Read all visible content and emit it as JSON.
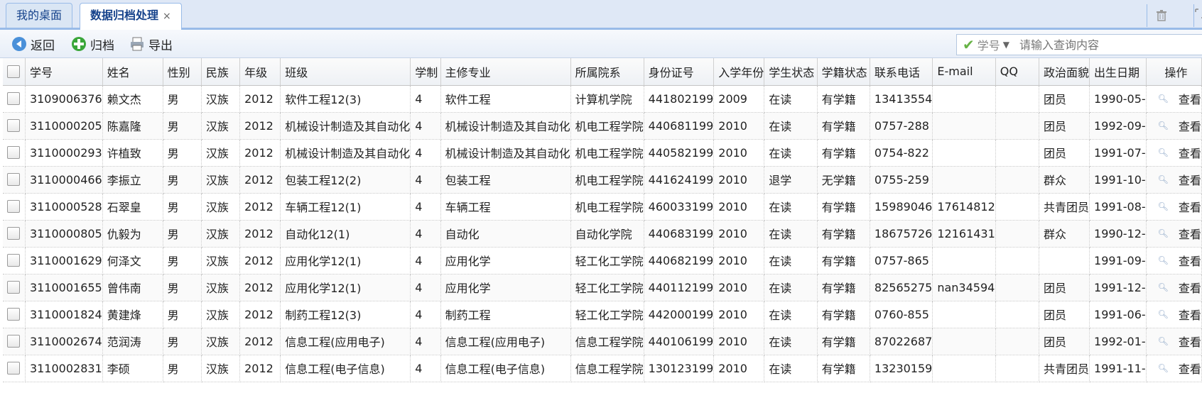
{
  "tabs": [
    {
      "label": "我的桌面",
      "active": false
    },
    {
      "label": "数据归档处理",
      "active": true,
      "close": "×"
    }
  ],
  "toolbar": {
    "back": "返回",
    "archive": "归档",
    "export": "导出"
  },
  "search": {
    "field": "学号",
    "placeholder": "请输入查询内容"
  },
  "columns": [
    "学号",
    "姓名",
    "性别",
    "民族",
    "年级",
    "班级",
    "学制",
    "主修专业",
    "所属院系",
    "身份证号",
    "入学年份",
    "学生状态",
    "学籍状态",
    "联系电话",
    "E-mail",
    "QQ",
    "政治面貌",
    "出生日期",
    "操作"
  ],
  "view_label": "查看",
  "rows": [
    [
      "3109006376",
      "赖文杰",
      "男",
      "汉族",
      "2012",
      "软件工程12(3)",
      "4",
      "软件工程",
      "计算机学院",
      "441802199",
      "2009",
      "在读",
      "有学籍",
      "13413554",
      "",
      "",
      "团员",
      "1990-05-"
    ],
    [
      "3110000205",
      "陈嘉隆",
      "男",
      "汉族",
      "2012",
      "机械设计制造及其自动化",
      "4",
      "机械设计制造及其自动化",
      "机电工程学院",
      "440681199",
      "2010",
      "在读",
      "有学籍",
      "0757-288",
      "",
      "",
      "团员",
      "1992-09-"
    ],
    [
      "3110000293",
      "许植致",
      "男",
      "汉族",
      "2012",
      "机械设计制造及其自动化",
      "4",
      "机械设计制造及其自动化",
      "机电工程学院",
      "440582199",
      "2010",
      "在读",
      "有学籍",
      "0754-822",
      "",
      "",
      "团员",
      "1991-07-"
    ],
    [
      "3110000466",
      "李振立",
      "男",
      "汉族",
      "2012",
      "包装工程12(2)",
      "4",
      "包装工程",
      "机电工程学院",
      "441624199",
      "2010",
      "退学",
      "无学籍",
      "0755-259",
      "",
      "",
      "群众",
      "1991-10-"
    ],
    [
      "3110000528",
      "石翠皇",
      "男",
      "汉族",
      "2012",
      "车辆工程12(1)",
      "4",
      "车辆工程",
      "机电工程学院",
      "460033199",
      "2010",
      "在读",
      "有学籍",
      "15989046",
      "17614812",
      "",
      "共青团员",
      "1991-08-"
    ],
    [
      "3110000805",
      "仇毅为",
      "男",
      "汉族",
      "2012",
      "自动化12(1)",
      "4",
      "自动化",
      "自动化学院",
      "440683199",
      "2010",
      "在读",
      "有学籍",
      "18675726",
      "12161431",
      "",
      "群众",
      "1990-12-"
    ],
    [
      "3110001629",
      "何泽文",
      "男",
      "汉族",
      "2012",
      "应用化学12(1)",
      "4",
      "应用化学",
      "轻工化工学院",
      "440682199",
      "2010",
      "在读",
      "有学籍",
      "0757-865",
      "",
      "",
      "",
      "1991-09-"
    ],
    [
      "3110001655",
      "曾伟南",
      "男",
      "汉族",
      "2012",
      "应用化学12(1)",
      "4",
      "应用化学",
      "轻工化工学院",
      "440112199",
      "2010",
      "在读",
      "有学籍",
      "82565275",
      "nan34594",
      "",
      "团员",
      "1991-12-"
    ],
    [
      "3110001824",
      "黄建烽",
      "男",
      "汉族",
      "2012",
      "制药工程12(3)",
      "4",
      "制药工程",
      "轻工化工学院",
      "442000199",
      "2010",
      "在读",
      "有学籍",
      "0760-855",
      "",
      "",
      "团员",
      "1991-06-"
    ],
    [
      "3110002674",
      "范润涛",
      "男",
      "汉族",
      "2012",
      "信息工程(应用电子)",
      "4",
      "信息工程(应用电子)",
      "信息工程学院",
      "440106199",
      "2010",
      "在读",
      "有学籍",
      "87022687",
      "",
      "",
      "团员",
      "1992-01-"
    ],
    [
      "3110002831",
      "李硕",
      "男",
      "汉族",
      "2012",
      "信息工程(电子信息)",
      "4",
      "信息工程(电子信息)",
      "信息工程学院",
      "130123199",
      "2010",
      "在读",
      "有学籍",
      "13230159",
      "",
      "",
      "共青团员",
      "1991-11-"
    ]
  ]
}
